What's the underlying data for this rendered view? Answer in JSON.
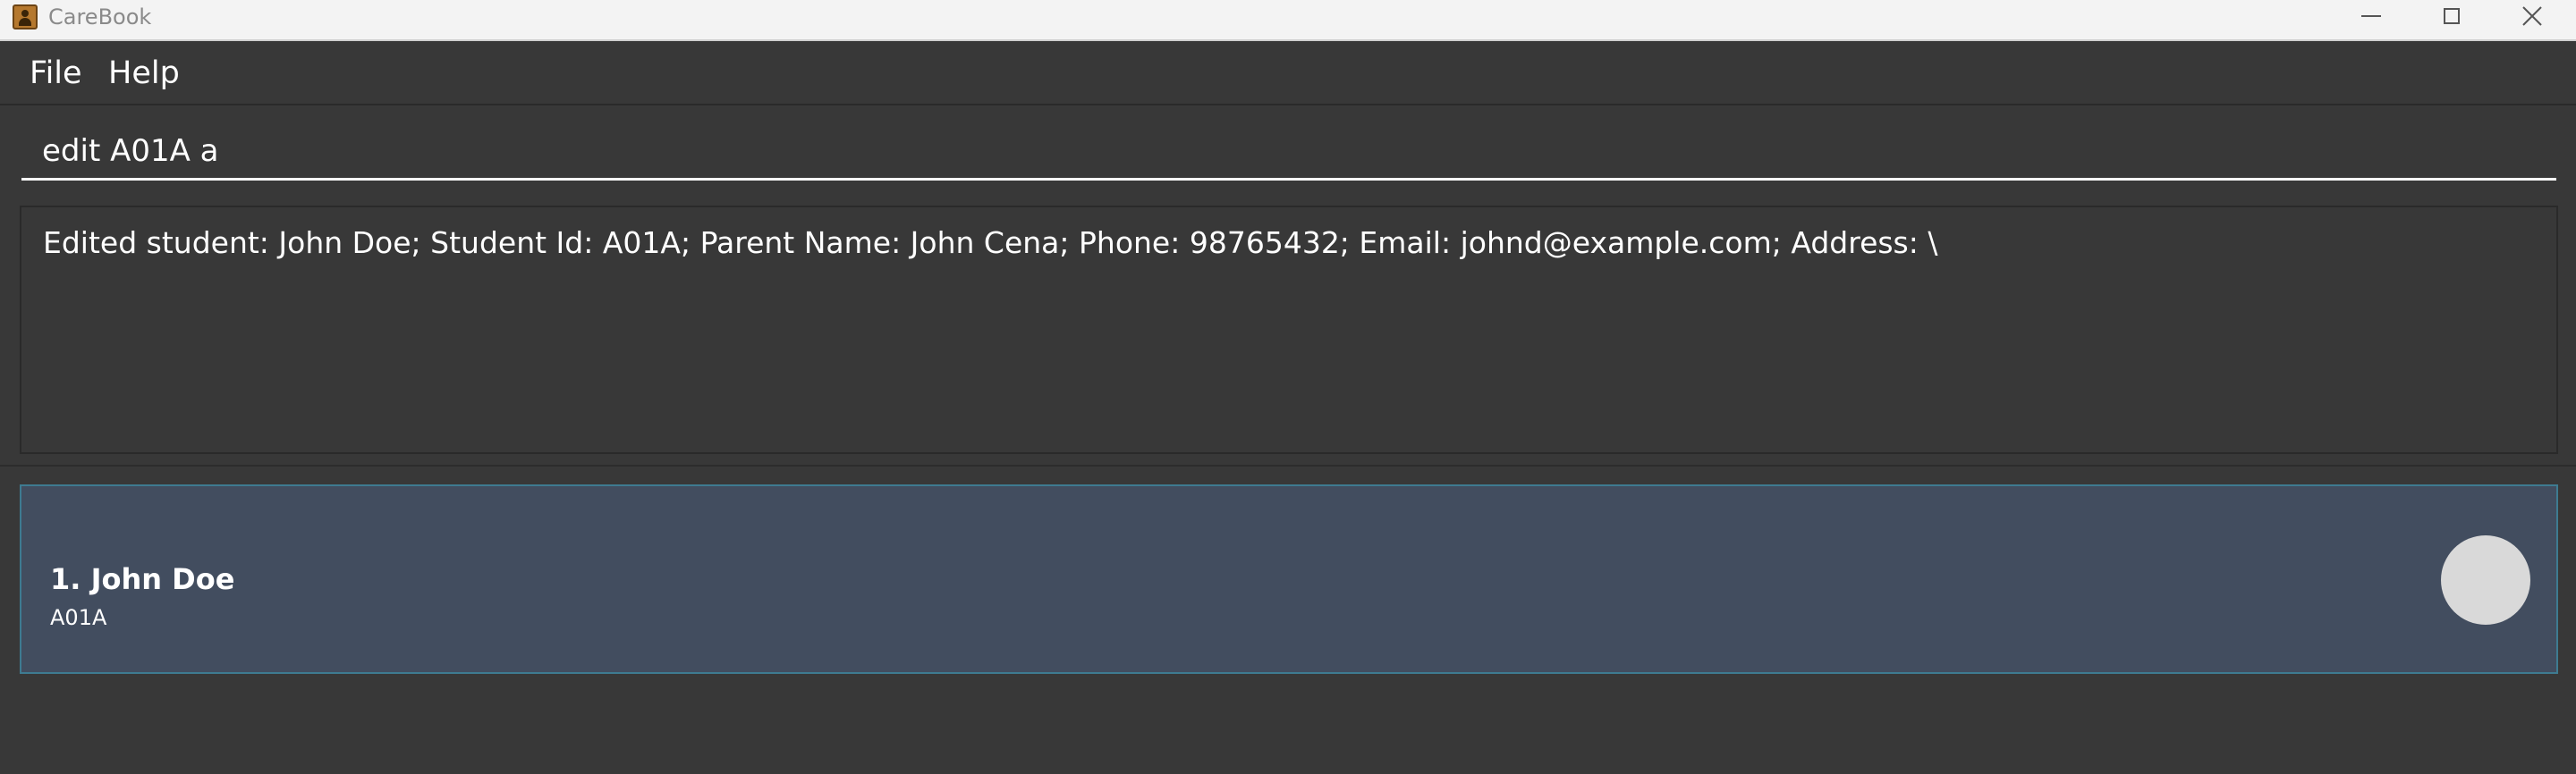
{
  "window": {
    "title": "CareBook",
    "controls": {
      "minimize_icon": "minimize-icon",
      "maximize_icon": "maximize-icon",
      "close_icon": "close-icon"
    }
  },
  "menu": {
    "items": [
      {
        "label": "File"
      },
      {
        "label": "Help"
      }
    ]
  },
  "command_box": {
    "value": "edit A01A a",
    "placeholder": ""
  },
  "result_display": {
    "text": "Edited student: John Doe; Student Id: A01A; Parent Name: John Cena; Phone: 98765432; Email: johnd@example.com; Address: \\"
  },
  "student_list": [
    {
      "index_name": "1. John Doe",
      "student_id": "A01A"
    }
  ],
  "colors": {
    "background": "#383838",
    "card_selected": "#424d5f",
    "card_border": "#3e7b91",
    "avatar": "#d9d9d9"
  }
}
